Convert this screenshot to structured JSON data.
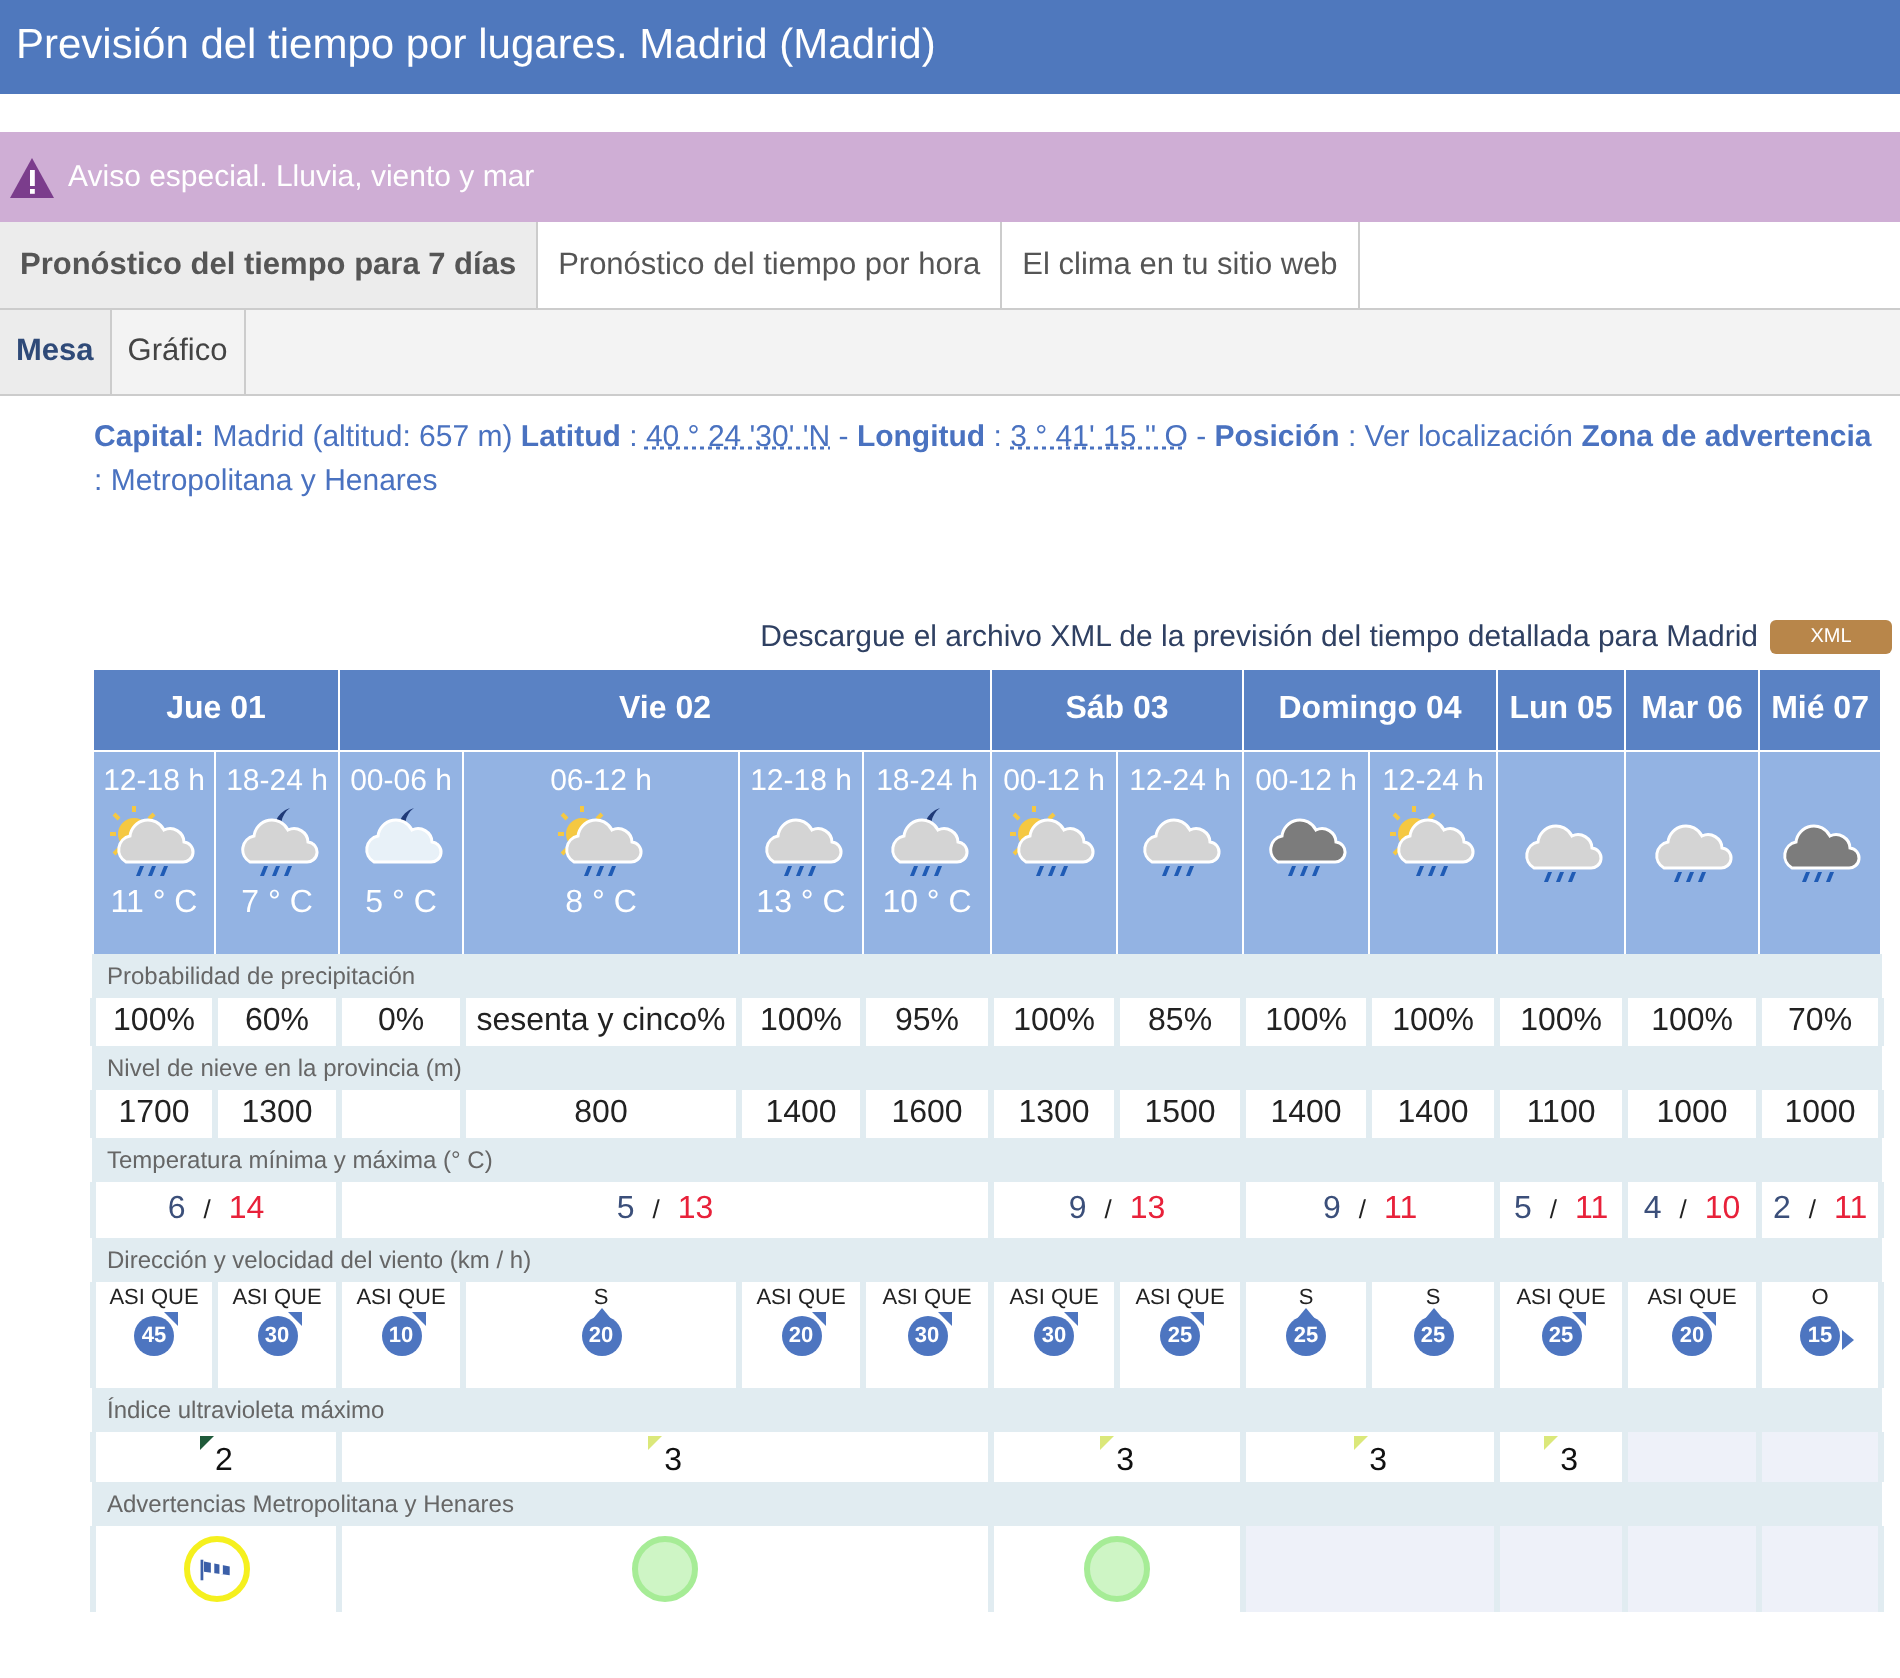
{
  "title": "Previsión del tiempo por lugares. Madrid (Madrid)",
  "alert": "Aviso especial. Lluvia, viento y mar",
  "tabs": [
    {
      "label": "Pronóstico del tiempo para 7 días",
      "selected": true
    },
    {
      "label": "Pronóstico del tiempo por hora",
      "selected": false
    },
    {
      "label": "El clima en tu sitio web",
      "selected": false
    }
  ],
  "subtabs": [
    {
      "label": "Mesa",
      "selected": true
    },
    {
      "label": "Gráfico",
      "selected": false
    }
  ],
  "info": [
    {
      "kind": "label",
      "text": "Capital:"
    },
    {
      "kind": "text",
      "text": "Madrid (altitud: 657 m)"
    },
    {
      "kind": "label",
      "text": "Latitud"
    },
    {
      "kind": "text",
      "text": ":"
    },
    {
      "kind": "coord",
      "text": "40 ° 24 '30' 'N"
    },
    {
      "kind": "text",
      "text": "-"
    },
    {
      "kind": "label",
      "text": "Longitud"
    },
    {
      "kind": "text",
      "text": ":"
    },
    {
      "kind": "coord",
      "text": "3 ° 41' 15 '' O"
    },
    {
      "kind": "text",
      "text": "-"
    },
    {
      "kind": "label",
      "text": "Posición"
    },
    {
      "kind": "text",
      "text": ":"
    },
    {
      "kind": "link",
      "text": "Ver localización"
    },
    {
      "kind": "label",
      "text": "Zona de advertencia"
    },
    {
      "kind": "text",
      "text": ":"
    },
    {
      "kind": "text",
      "text": "Metropolitana y Henares"
    }
  ],
  "download": {
    "text": "Descargue el archivo XML de la previsión del tiempo detallada para Madrid",
    "button": "XML"
  },
  "row_labels": [
    "Probabilidad de precipitación",
    "Nivel de nieve en la provincia (m)",
    "Temperatura mínima y máxima (° C)",
    "Dirección y velocidad del viento (km / h)",
    "Índice ultravioleta máximo",
    "Advertencias Metropolitana y Henares"
  ],
  "days": [
    {
      "label": "Jue 01",
      "min": "6",
      "separator": "/",
      "max": "14",
      "uv": {
        "value": "2",
        "color": "#1f5a3a"
      },
      "warning": {
        "kind": "wind",
        "color": "#f5f01e"
      },
      "periods": [
        {
          "label": "12-18 h",
          "kind": "sun_cloud_rain",
          "temp": "11 ° C",
          "precip": "100%",
          "snow": "1700",
          "wind": {
            "kind": "top_right",
            "direction": "ASI QUE",
            "speed": "45"
          }
        },
        {
          "label": "18-24 h",
          "kind": "moon_cloud_rain",
          "temp": "7 ° C",
          "precip": "60%",
          "snow": "1300",
          "wind": {
            "kind": "top_right",
            "direction": "ASI QUE",
            "speed": "30"
          }
        }
      ]
    },
    {
      "label": "Vie 02",
      "min": "5",
      "separator": "/",
      "max": "13",
      "uv": {
        "value": "3",
        "color": "#dbe87a"
      },
      "warning": {
        "kind": "none",
        "color": "#a6ec96"
      },
      "periods": [
        {
          "label": "00-06 h",
          "kind": "moon_cloud",
          "temp": "5 ° C",
          "precip": "0%",
          "wind": {
            "kind": "top_right",
            "direction": "ASI QUE",
            "speed": "10"
          }
        },
        {
          "label": "06-12 h",
          "kind": "sun_cloud_rain",
          "temp": "8 ° C",
          "precip": "sesenta y cinco%",
          "snow": "800",
          "wind": {
            "kind": "top",
            "direction": "S",
            "speed": "20"
          }
        },
        {
          "label": "12-18 h",
          "kind": "cloud_rain",
          "temp": "13 ° C",
          "precip": "100%",
          "snow": "1400",
          "wind": {
            "kind": "top_right",
            "direction": "ASI QUE",
            "speed": "20"
          }
        },
        {
          "label": "18-24 h",
          "kind": "moon_cloud_rain",
          "temp": "10 ° C",
          "precip": "95%",
          "snow": "1600",
          "wind": {
            "kind": "top_right",
            "direction": "ASI QUE",
            "speed": "30"
          }
        }
      ]
    },
    {
      "label": "Sáb 03",
      "min": "9",
      "separator": "/",
      "max": "13",
      "uv": {
        "value": "3",
        "color": "#dbe87a"
      },
      "warning": {
        "kind": "none",
        "color": "#a6ec96"
      },
      "periods": [
        {
          "label": "00-12 h",
          "kind": "sun_cloud_rain",
          "precip": "100%",
          "snow": "1300",
          "wind": {
            "kind": "top_right",
            "direction": "ASI QUE",
            "speed": "30"
          }
        },
        {
          "label": "12-24 h",
          "kind": "cloud_rain",
          "precip": "85%",
          "snow": "1500",
          "wind": {
            "kind": "top_right",
            "direction": "ASI QUE",
            "speed": "25"
          }
        }
      ]
    },
    {
      "label": "Domingo 04",
      "min": "9",
      "separator": "/",
      "max": "11",
      "uv": {
        "value": "3",
        "color": "#dbe87a"
      },
      "periods": [
        {
          "label": "00-12 h",
          "kind": "dark_cloud_rain",
          "precip": "100%",
          "snow": "1400",
          "wind": {
            "kind": "top",
            "direction": "S",
            "speed": "25"
          }
        },
        {
          "label": "12-24 h",
          "kind": "sun_cloud_rain",
          "precip": "100%",
          "snow": "1400",
          "wind": {
            "kind": "top",
            "direction": "S",
            "speed": "25"
          }
        }
      ]
    },
    {
      "label": "Lun 05",
      "min": "5",
      "separator": "/",
      "max": "11",
      "uv": {
        "value": "3",
        "color": "#dbe87a"
      },
      "periods": [
        {
          "kind": "cloud_rain",
          "precip": "100%",
          "snow": "1100",
          "wind": {
            "kind": "top_right",
            "direction": "ASI QUE",
            "speed": "25"
          }
        }
      ]
    },
    {
      "label": "Mar 06",
      "min": "4",
      "separator": "/",
      "max": "10",
      "periods": [
        {
          "kind": "cloud_rain",
          "precip": "100%",
          "snow": "1000",
          "wind": {
            "kind": "top_right",
            "direction": "ASI QUE",
            "speed": "20"
          }
        }
      ]
    },
    {
      "label": "Mié 07",
      "min": "2",
      "separator": "/",
      "max": "11",
      "periods": [
        {
          "kind": "dark_cloud_rain",
          "precip": "70%",
          "snow": "1000",
          "wind": {
            "kind": "right",
            "direction": "O",
            "speed": "15"
          }
        }
      ]
    }
  ]
}
